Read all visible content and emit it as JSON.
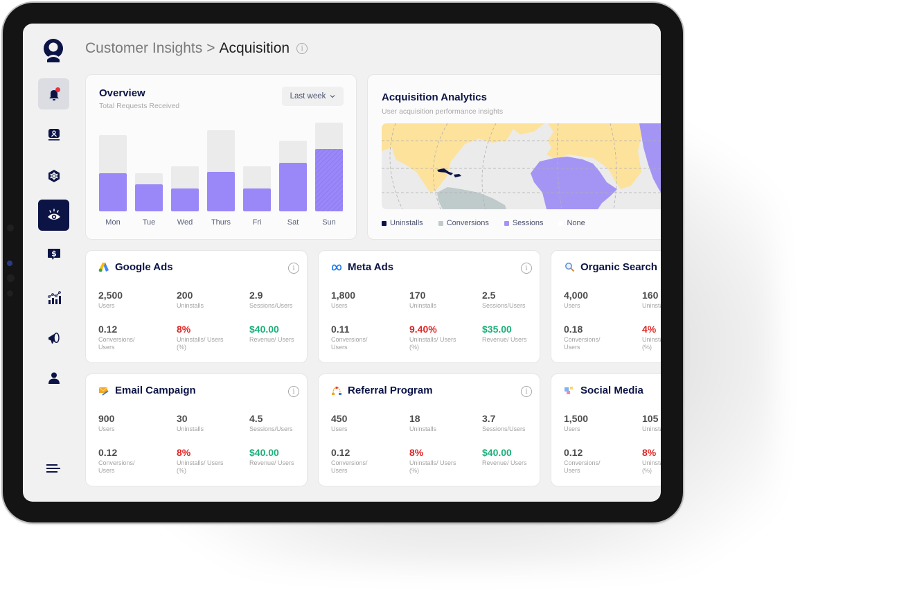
{
  "breadcrumb": {
    "parent": "Customer Insights",
    "separator": ">",
    "current": "Acquisition"
  },
  "sidebar": {
    "items": [
      {
        "name": "notifications",
        "icon": "bell-icon",
        "state": "hover",
        "has_badge": true
      },
      {
        "name": "user-monitor",
        "icon": "user-monitor-icon"
      },
      {
        "name": "network",
        "icon": "network-icon"
      },
      {
        "name": "insights",
        "icon": "eye-icon",
        "state": "active"
      },
      {
        "name": "billing",
        "icon": "dollar-chat-icon"
      },
      {
        "name": "analytics",
        "icon": "chart-icon"
      },
      {
        "name": "campaigns",
        "icon": "megaphone-icon"
      },
      {
        "name": "profile",
        "icon": "person-icon"
      }
    ],
    "menu_icon": "hamburger-icon"
  },
  "overview": {
    "title": "Overview",
    "subtitle": "Total Requests Received",
    "range_label": "Last week",
    "chart_data": {
      "type": "bar",
      "categories": [
        "Mon",
        "Tue",
        "Wed",
        "Thurs",
        "Fri",
        "Sat",
        "Sun"
      ],
      "series": [
        {
          "name": "Total",
          "values": [
            110,
            55,
            65,
            117,
            65,
            102,
            128
          ]
        },
        {
          "name": "Received",
          "values": [
            55,
            39,
            33,
            57,
            33,
            70,
            90
          ]
        }
      ],
      "highlighted_category": "Sun",
      "ylim": [
        0,
        130
      ],
      "colors": {
        "total": "#ebebeb",
        "received": "#9a88f8"
      },
      "grid": false
    }
  },
  "acquisition": {
    "title": "Acquisition Analytics",
    "subtitle": "User acquisition performance insights",
    "legend": [
      {
        "label": "Uninstalls",
        "color": "#0c1446"
      },
      {
        "label": "Conversions",
        "color": "#bfcacb"
      },
      {
        "label": "Sessions",
        "color": "#a495f5"
      },
      {
        "label": "None",
        "color": "#ffffff"
      }
    ],
    "map_colors": {
      "ocean": "#ebebeb",
      "land_none": "#fde29c"
    }
  },
  "channels": [
    {
      "name": "Google Ads",
      "icon": "google-ads-icon",
      "users": "2,500",
      "uninstalls": "200",
      "sessions_per_user": "2.9",
      "conversions_per_user": "0.12",
      "uninstall_rate": "8%",
      "revenue_per_user": "$40.00"
    },
    {
      "name": "Meta Ads",
      "icon": "meta-icon",
      "users": "1,800",
      "uninstalls": "170",
      "sessions_per_user": "2.5",
      "conversions_per_user": "0.11",
      "uninstall_rate": "9.40%",
      "revenue_per_user": "$35.00"
    },
    {
      "name": "Organic Search",
      "icon": "search-icon",
      "users": "4,000",
      "uninstalls": "160",
      "conversions_per_user": "0.18",
      "uninstall_rate": "4%"
    },
    {
      "name": "Email Campaign",
      "icon": "email-icon",
      "users": "900",
      "uninstalls": "30",
      "sessions_per_user": "4.5",
      "conversions_per_user": "0.12",
      "uninstall_rate": "8%",
      "revenue_per_user": "$40.00"
    },
    {
      "name": "Referral Program",
      "icon": "referral-icon",
      "users": "450",
      "uninstalls": "18",
      "sessions_per_user": "3.7",
      "conversions_per_user": "0.12",
      "uninstall_rate": "8%",
      "revenue_per_user": "$40.00"
    },
    {
      "name": "Social Media",
      "icon": "social-media-icon",
      "users": "1,500",
      "uninstalls": "105",
      "conversions_per_user": "0.12",
      "uninstall_rate": "8%"
    }
  ],
  "metric_labels": {
    "users": "Users",
    "uninstalls": "Uninstalls",
    "sessions_per_user": "Sessions/Users",
    "conversions_per_user": "Conversions/ Users",
    "uninstall_rate": "Uninstalls/ Users (%)",
    "revenue_per_user": "Revenue/ Users"
  }
}
